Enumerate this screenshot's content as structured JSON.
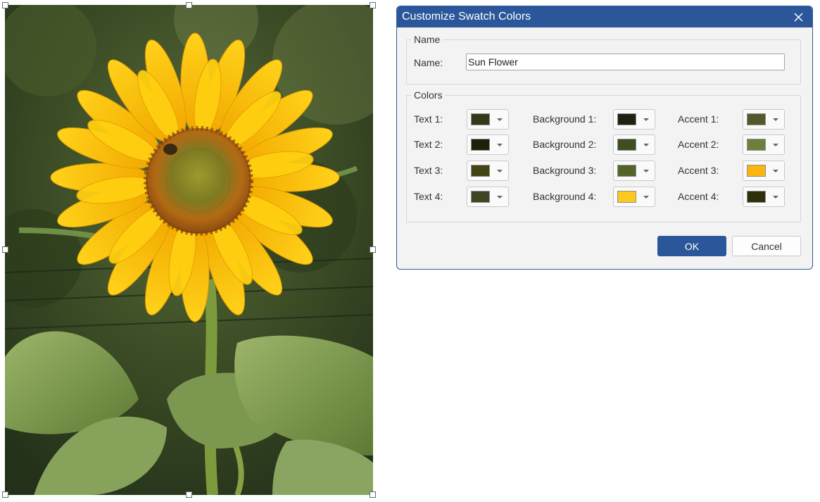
{
  "dialog": {
    "title": "Customize Swatch Colors",
    "name_group_legend": "Name",
    "name_label": "Name:",
    "name_value": "Sun Flower",
    "colors_group_legend": "Colors",
    "ok_label": "OK",
    "cancel_label": "Cancel",
    "close_icon": "close-icon"
  },
  "colors": {
    "text": [
      {
        "label": "Text 1:",
        "color": "#333818"
      },
      {
        "label": "Text 2:",
        "color": "#1e1f08"
      },
      {
        "label": "Text 3:",
        "color": "#434515"
      },
      {
        "label": "Text 4:",
        "color": "#424426"
      }
    ],
    "background": [
      {
        "label": "Background 1:",
        "color": "#1f2210"
      },
      {
        "label": "Background 2:",
        "color": "#3e4e23"
      },
      {
        "label": "Background 3:",
        "color": "#546428"
      },
      {
        "label": "Background 4:",
        "color": "#fdc91f"
      }
    ],
    "accent": [
      {
        "label": "Accent 1:",
        "color": "#55582a"
      },
      {
        "label": "Accent 2:",
        "color": "#6e7f3b"
      },
      {
        "label": "Accent 3:",
        "color": "#fcb410"
      },
      {
        "label": "Accent 4:",
        "color": "#2f2f09"
      }
    ]
  },
  "theme": {
    "accent": "#2b579a",
    "dialog_bg": "#f3f3f3"
  },
  "image": {
    "subject": "sunflower photo"
  }
}
